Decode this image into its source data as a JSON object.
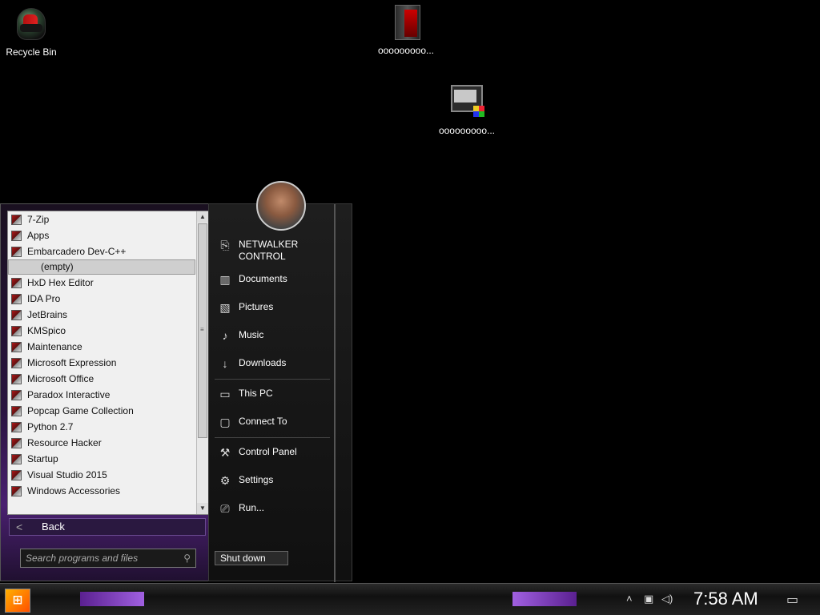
{
  "desktop": {
    "icons": [
      {
        "label": "Recycle Bin"
      },
      {
        "label": "ooooooooo..."
      },
      {
        "label": "ooooooooo..."
      }
    ]
  },
  "start_menu": {
    "programs": [
      "7-Zip",
      "Apps",
      "Embarcadero Dev-C++",
      "(empty)",
      "HxD Hex Editor",
      "IDA Pro",
      "JetBrains",
      "KMSpico",
      "Maintenance",
      "Microsoft Expression",
      "Microsoft Office",
      "Paradox Interactive",
      "Popcap Game Collection",
      "Python 2.7",
      "Resource Hacker",
      "Startup",
      "Visual Studio 2015",
      "Windows Accessories"
    ],
    "back_label": "Back",
    "search_placeholder": "Search programs and files",
    "right_items": [
      {
        "label": "NETWALKER\nCONTROL",
        "icon": "user-search-icon"
      },
      {
        "label": "Documents",
        "icon": "books-icon"
      },
      {
        "label": "Pictures",
        "icon": "picture-icon"
      },
      {
        "label": "Music",
        "icon": "music-note-icon"
      },
      {
        "label": "Downloads",
        "icon": "download-icon"
      },
      {
        "label": "This PC",
        "icon": "laptop-icon"
      },
      {
        "label": "Connect To",
        "icon": "monitor-icon"
      },
      {
        "label": "Control Panel",
        "icon": "wrench-icon"
      },
      {
        "label": "Settings",
        "icon": "gear-icon"
      },
      {
        "label": "Run...",
        "icon": "run-icon"
      }
    ],
    "shutdown_label": "Shut down"
  },
  "taskbar": {
    "clock": "7:58 AM",
    "tray_icons": [
      "chevron-up-icon",
      "network-icon",
      "volume-icon",
      "action-center-icon"
    ],
    "accent": "#a060e0"
  }
}
